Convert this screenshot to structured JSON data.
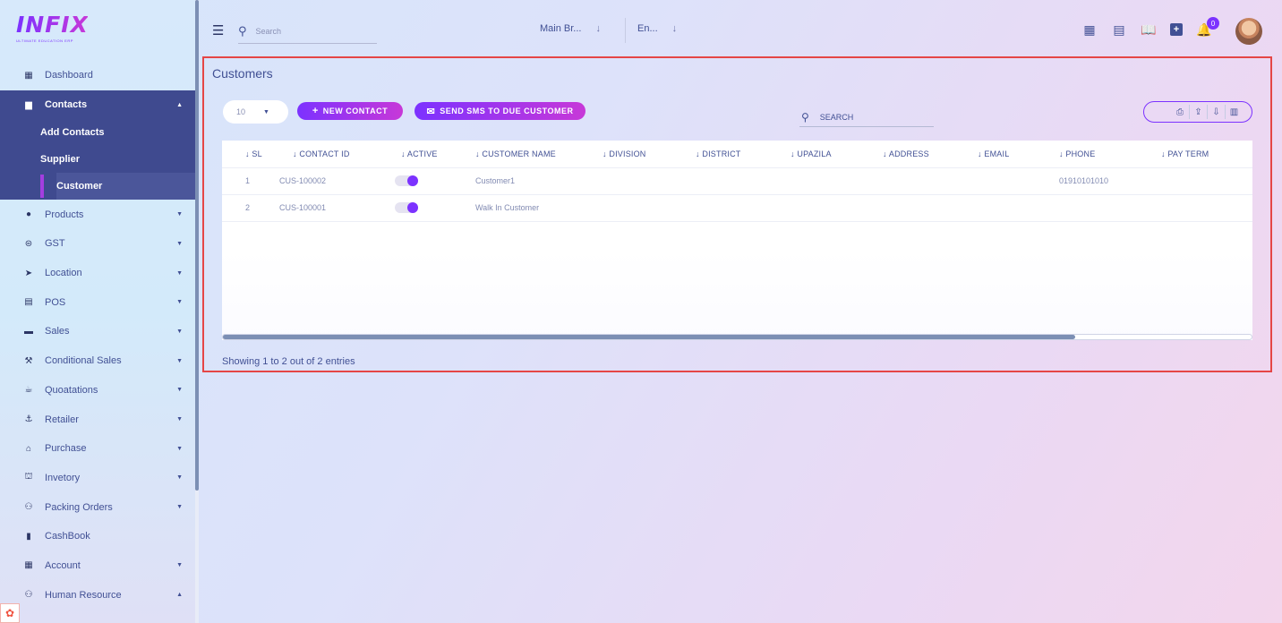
{
  "brand": {
    "name": "INFIX",
    "tagline": "ULTIMATE EDUCATION ERP"
  },
  "sidebar": {
    "items": [
      {
        "label": "Dashboard",
        "icon": "grid-icon"
      },
      {
        "label": "Contacts",
        "icon": "document-icon",
        "expanded": true,
        "children": [
          {
            "label": "Add Contacts"
          },
          {
            "label": "Supplier"
          },
          {
            "label": "Customer",
            "current": true
          }
        ]
      },
      {
        "label": "Products",
        "icon": "product-icon"
      },
      {
        "label": "GST",
        "icon": "gst-icon"
      },
      {
        "label": "Location",
        "icon": "location-arrow-icon"
      },
      {
        "label": "POS",
        "icon": "cash-register-icon"
      },
      {
        "label": "Sales",
        "icon": "sales-icon"
      },
      {
        "label": "Conditional Sales",
        "icon": "gavel-icon"
      },
      {
        "label": "Quoatations",
        "icon": "coffee-icon"
      },
      {
        "label": "Retailer",
        "icon": "anchor-icon"
      },
      {
        "label": "Purchase",
        "icon": "store-icon"
      },
      {
        "label": "Invetory",
        "icon": "bank-icon"
      },
      {
        "label": "Packing Orders",
        "icon": "users-icon"
      },
      {
        "label": "CashBook",
        "icon": "book-icon"
      },
      {
        "label": "Account",
        "icon": "calculator-icon"
      },
      {
        "label": "Human Resource",
        "icon": "users-icon"
      }
    ]
  },
  "header": {
    "search_placeholder": "Search",
    "branch": "Main Br...",
    "language": "En...",
    "notification_count": "0"
  },
  "page": {
    "title": "Customers",
    "page_size": "10",
    "new_contact_label": "NEW CONTACT",
    "sms_label": "SEND SMS TO DUE CUSTOMER",
    "table_search_placeholder": "SEARCH",
    "columns": [
      "↓ SL",
      "↓ CONTACT ID",
      "↓ ACTIVE",
      "↓ CUSTOMER NAME",
      "↓ DIVISION",
      "↓ DISTRICT",
      "↓ UPAZILA",
      "↓ ADDRESS",
      "↓ EMAIL",
      "↓ PHONE",
      "↓ PAY TERM"
    ],
    "rows": [
      {
        "sl": "1",
        "contact_id": "CUS-100002",
        "active": true,
        "name": "Customer1",
        "division": "",
        "district": "",
        "upazila": "",
        "address": "",
        "email": "",
        "phone": "01910101010",
        "pay_term": ""
      },
      {
        "sl": "2",
        "contact_id": "CUS-100001",
        "active": true,
        "name": "Walk In Customer",
        "division": "",
        "district": "",
        "upazila": "",
        "address": "",
        "email": "",
        "phone": "",
        "pay_term": ""
      }
    ],
    "footer": "Showing 1 to 2 out of 2 entries"
  },
  "colors": {
    "accent": "#7c32ff",
    "accent2": "#c738d8",
    "sidebar_active": "#3f4a8f",
    "text": "#415094",
    "highlight_border": "#e54646"
  }
}
